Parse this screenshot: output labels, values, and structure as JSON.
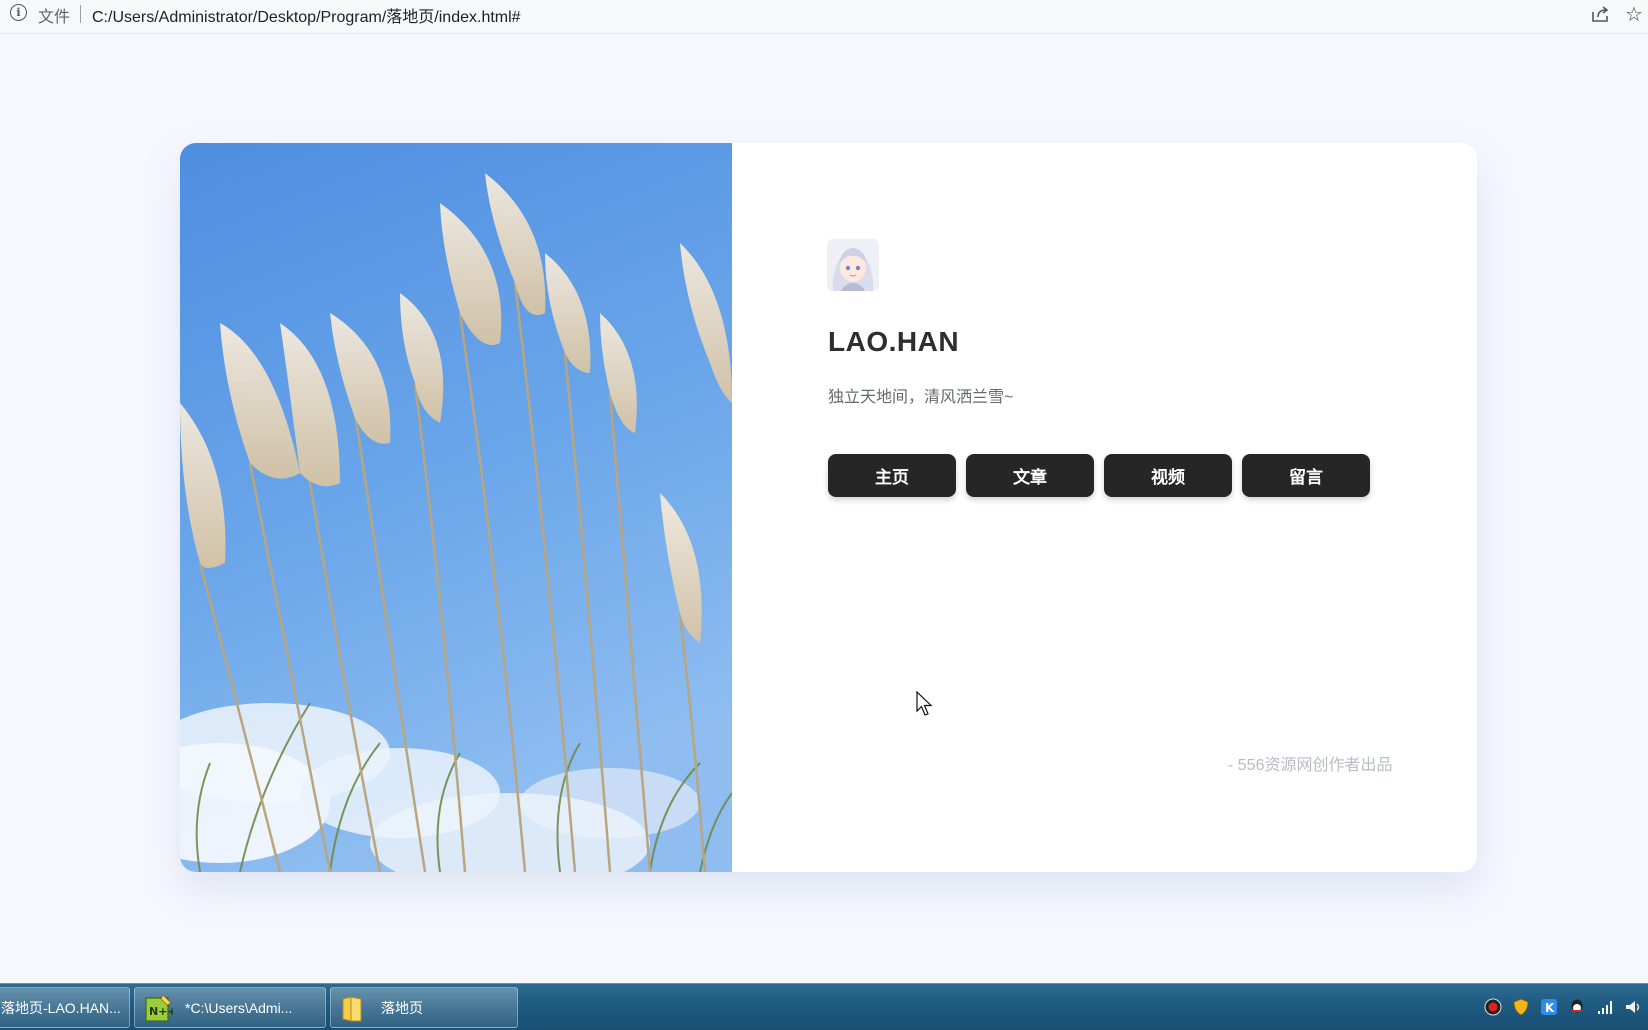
{
  "browser": {
    "file_label": "文件",
    "url": "C:/Users/Administrator/Desktop/Program/落地页/index.html#"
  },
  "profile": {
    "name": "LAO.HAN",
    "motto": "独立天地间，清风洒兰雪~",
    "nav": [
      "主页",
      "文章",
      "视频",
      "留言"
    ],
    "credit": "- 556资源网创作者出品"
  },
  "taskbar": {
    "items": [
      "落地页-LAO.HAN...",
      "*C:\\Users\\Admi...",
      "落地页"
    ]
  },
  "colors": {
    "page_bg": "#f6f8fe",
    "card_bg": "#ffffff",
    "button_bg": "#262626",
    "sky": "#5a9ae6"
  }
}
